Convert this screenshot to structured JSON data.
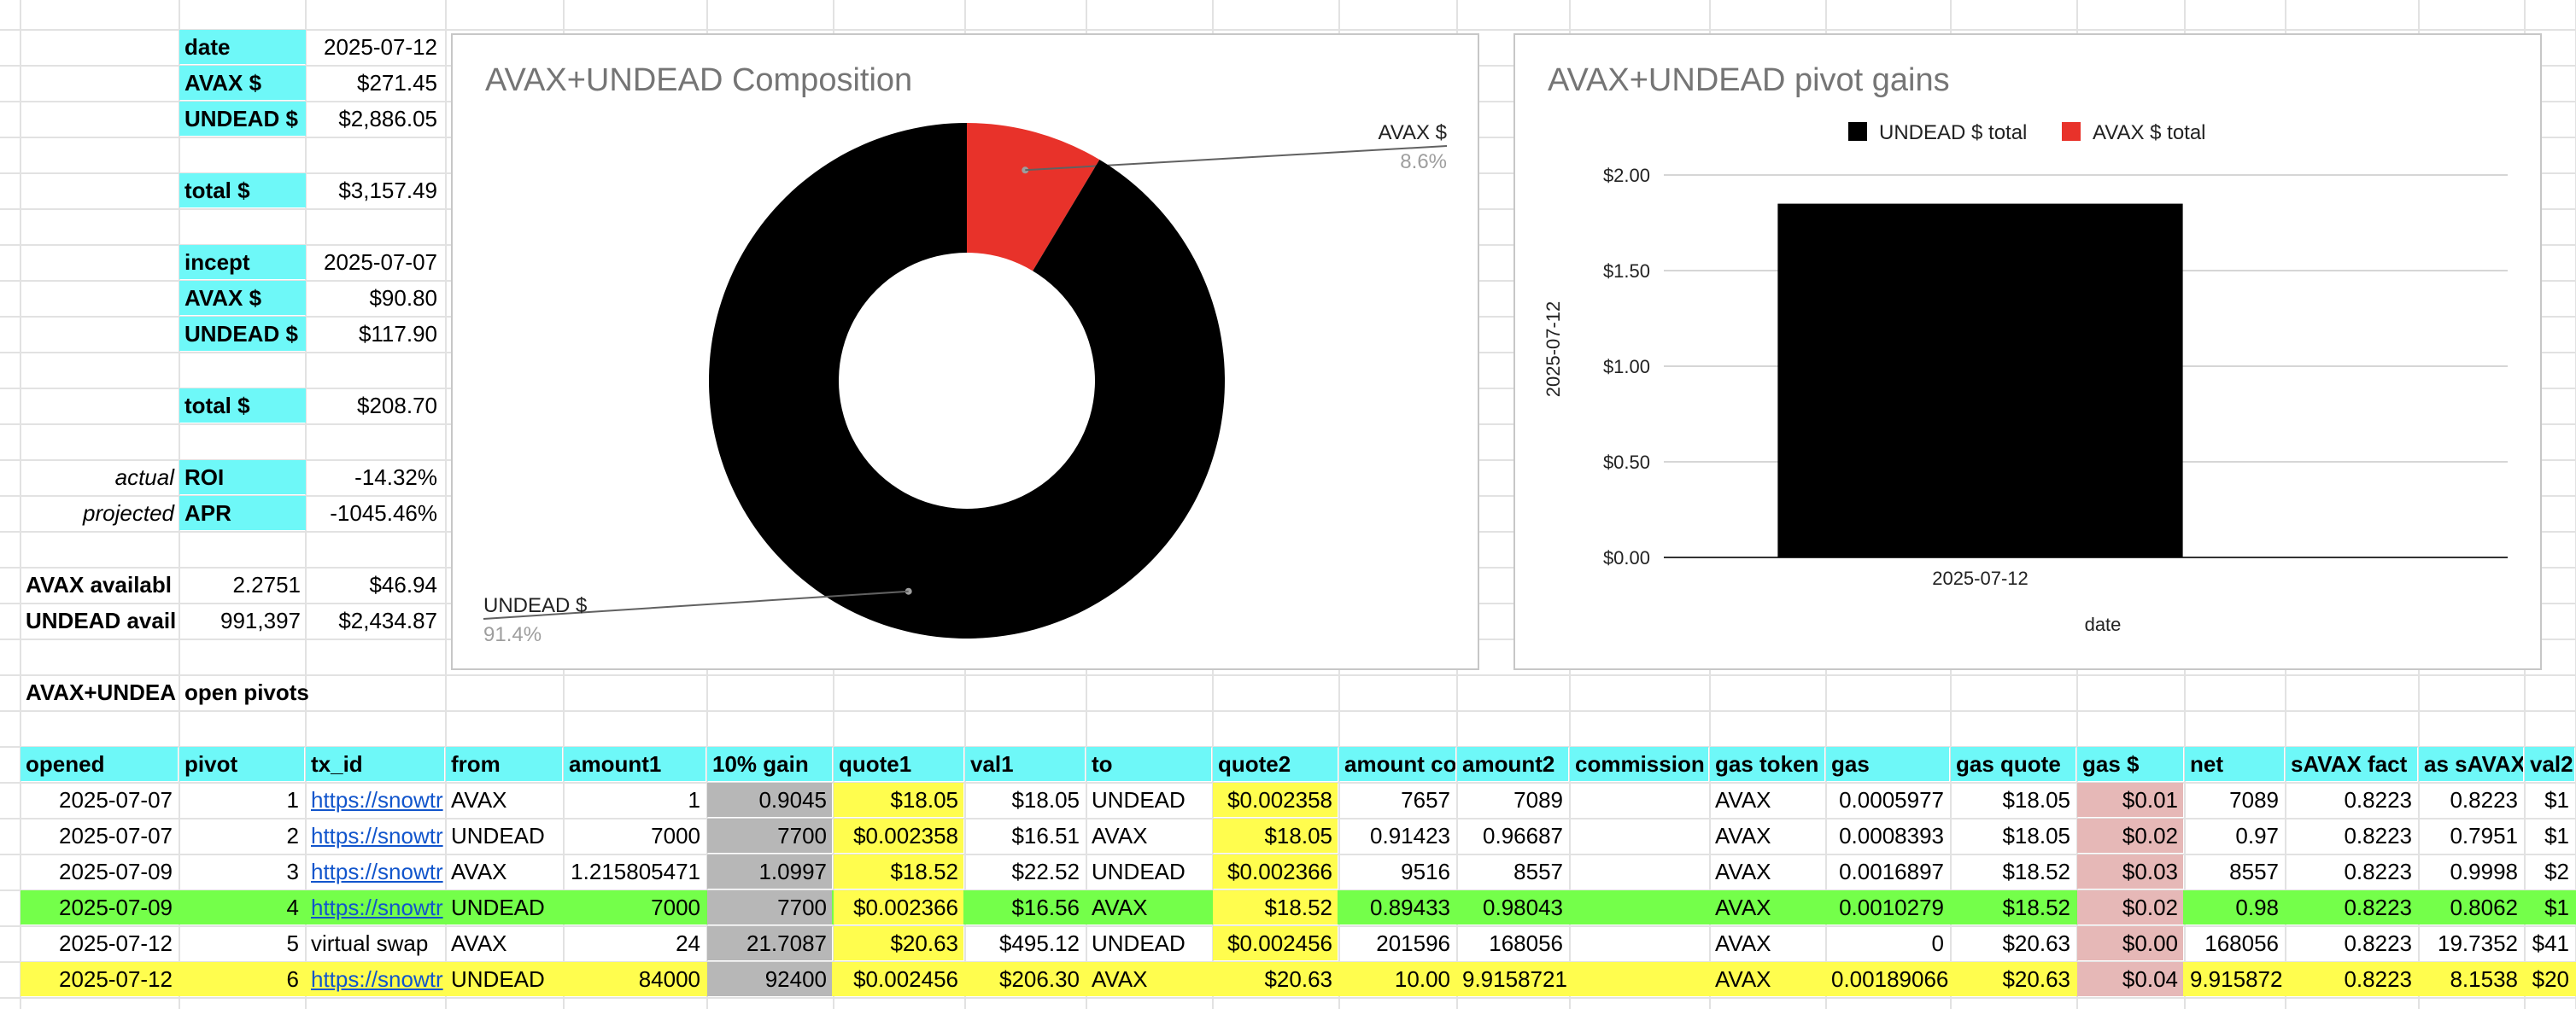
{
  "summary": {
    "date_label": "date",
    "date_value": "2025-07-12",
    "avax_label": "AVAX $",
    "avax_value": "$271.45",
    "undead_label": "UNDEAD $",
    "undead_value": "$2,886.05",
    "total_label": "total $",
    "total_value": "$3,157.49",
    "incept_label": "incept",
    "incept_value": "2025-07-07",
    "incept_avax_label": "AVAX $",
    "incept_avax_value": "$90.80",
    "incept_undead_label": "UNDEAD $",
    "incept_undead_value": "$117.90",
    "incept_total_label": "total $",
    "incept_total_value": "$208.70",
    "roi_prefix": "actual",
    "roi_label": "ROI",
    "roi_value": "-14.32%",
    "apr_prefix": "projected",
    "apr_label": "APR",
    "apr_value": "-1045.46%",
    "avax_available_label": "AVAX availabl",
    "avax_available_amount": "2.2751",
    "avax_available_value": "$46.94",
    "undead_available_label": "UNDEAD avail",
    "undead_available_amount": "991,397",
    "undead_available_value": "$2,434.87",
    "open_pivots_title": "AVAX+UNDEA",
    "open_pivots_title2": "open pivots"
  },
  "table": {
    "headers": [
      "opened",
      "pivot",
      "tx_id",
      "from",
      "amount1",
      "10% gain",
      "quote1",
      "val1",
      "to",
      "quote2",
      "amount co",
      "amount2",
      "commission",
      "gas token",
      "gas",
      "gas quote",
      "gas $",
      "net",
      "sAVAX fact",
      "as sAVAX",
      "val2"
    ],
    "rows": [
      [
        "2025-07-07",
        "1",
        "https://snowtr",
        "AVAX",
        "1",
        "0.9045",
        "$18.05",
        "$18.05",
        "UNDEAD",
        "$0.002358",
        "7657",
        "7089",
        "",
        "AVAX",
        "0.0005977",
        "$18.05",
        "$0.01",
        "7089",
        "0.8223",
        "0.8223",
        "$1"
      ],
      [
        "2025-07-07",
        "2",
        "https://snowtr",
        "UNDEAD",
        "7000",
        "7700",
        "$0.002358",
        "$16.51",
        "AVAX",
        "$18.05",
        "0.91423",
        "0.96687",
        "",
        "AVAX",
        "0.0008393",
        "$18.05",
        "$0.02",
        "0.97",
        "0.8223",
        "0.7951",
        "$1"
      ],
      [
        "2025-07-09",
        "3",
        "https://snowtr",
        "AVAX",
        "1.215805471",
        "1.0997",
        "$18.52",
        "$22.52",
        "UNDEAD",
        "$0.002366",
        "9516",
        "8557",
        "",
        "AVAX",
        "0.0016897",
        "$18.52",
        "$0.03",
        "8557",
        "0.8223",
        "0.9998",
        "$2"
      ],
      [
        "2025-07-09",
        "4",
        "https://snowtr",
        "UNDEAD",
        "7000",
        "7700",
        "$0.002366",
        "$16.56",
        "AVAX",
        "$18.52",
        "0.89433",
        "0.98043",
        "",
        "AVAX",
        "0.0010279",
        "$18.52",
        "$0.02",
        "0.98",
        "0.8223",
        "0.8062",
        "$1"
      ],
      [
        "2025-07-12",
        "5",
        "virtual swap",
        "AVAX",
        "24",
        "21.7087",
        "$20.63",
        "$495.12",
        "UNDEAD",
        "$0.002456",
        "201596",
        "168056",
        "",
        "AVAX",
        "0",
        "$20.63",
        "$0.00",
        "168056",
        "0.8223",
        "19.7352",
        "$41"
      ],
      [
        "2025-07-12",
        "6",
        "https://snowtr",
        "UNDEAD",
        "84000",
        "92400",
        "$0.002456",
        "$206.30",
        "AVAX",
        "$20.63",
        "10.00",
        "9.9158721",
        "",
        "AVAX",
        "0.00189066",
        "$20.63",
        "$0.04",
        "9.915872",
        "0.8223",
        "8.1538",
        "$20"
      ]
    ],
    "row_highlight": [
      "none",
      "none",
      "none",
      "green",
      "none",
      "yellow"
    ]
  },
  "chart_data": [
    {
      "type": "pie",
      "title": "AVAX+UNDEAD Composition",
      "donut": true,
      "labels": [
        "AVAX $",
        "UNDEAD $"
      ],
      "values": [
        271.45,
        2886.05
      ],
      "percent_labels": [
        "8.6%",
        "91.4%"
      ],
      "colors": [
        "#e8322a",
        "#000000"
      ]
    },
    {
      "type": "bar",
      "title": "AVAX+UNDEAD pivot gains",
      "categories": [
        "2025-07-12"
      ],
      "series": [
        {
          "name": "UNDEAD $ total",
          "values": [
            1.85
          ],
          "color": "#000000"
        },
        {
          "name": "AVAX $ total",
          "values": [
            0
          ],
          "color": "#e8322a"
        }
      ],
      "xlabel": "date",
      "ylabel": "2025-07-12",
      "ylim": [
        0,
        2
      ],
      "yticks": [
        "$0.00",
        "$0.50",
        "$1.00",
        "$1.50",
        "$2.00"
      ],
      "grid": true,
      "legend": "top"
    }
  ]
}
